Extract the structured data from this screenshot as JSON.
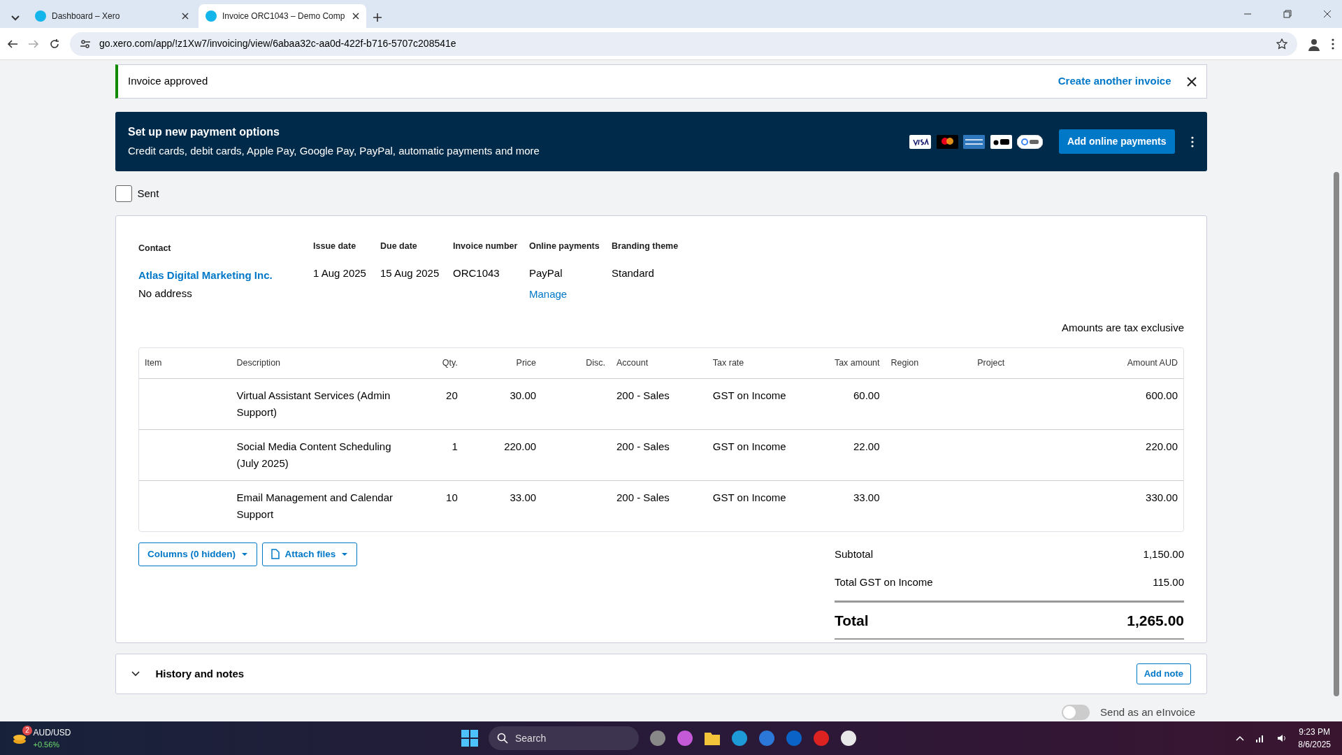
{
  "browser": {
    "tabs": [
      {
        "title": "Dashboard – Xero",
        "selected": false
      },
      {
        "title": "Invoice ORC1043 – Demo Comp",
        "selected": true
      }
    ],
    "url": "go.xero.com/app/!z1Xw7/invoicing/view/6abaa32c-aa0d-422f-b716-5707c208541e"
  },
  "alert": {
    "message": "Invoice approved",
    "action": "Create another invoice"
  },
  "banner": {
    "title": "Set up new payment options",
    "text": "Credit cards, debit cards, Apple Pay, Google Pay, PayPal, automatic payments and more",
    "button": "Add online payments"
  },
  "sent": {
    "label": "Sent",
    "checked": false
  },
  "invoice": {
    "fields": [
      {
        "label": "Contact",
        "kind": "contact",
        "value": "Atlas Digital Marketing Inc.",
        "sub": "No address"
      },
      {
        "label": "Issue date",
        "kind": "text",
        "value": "1 Aug 2025"
      },
      {
        "label": "Due date",
        "kind": "text",
        "value": "15 Aug 2025"
      },
      {
        "label": "Invoice number",
        "kind": "text",
        "value": "ORC1043"
      },
      {
        "label": "Online payments",
        "kind": "link",
        "value": "PayPal",
        "sub": "Manage"
      },
      {
        "label": "Branding theme",
        "kind": "text",
        "value": "Standard"
      }
    ],
    "tax_note": "Amounts are tax exclusive",
    "table": {
      "columns": [
        "Item",
        "Description",
        "Qty.",
        "Price",
        "Disc.",
        "Account",
        "Tax rate",
        "Tax amount",
        "Region",
        "Project",
        "Amount AUD"
      ],
      "rows": [
        [
          "",
          "Virtual Assistant Services (Admin Support)",
          "20",
          "30.00",
          "",
          "200 - Sales",
          "GST on Income",
          "60.00",
          "",
          "",
          "600.00"
        ],
        [
          "",
          "Social Media Content Scheduling (July 2025)",
          "1",
          "220.00",
          "",
          "200 - Sales",
          "GST on Income",
          "22.00",
          "",
          "",
          "220.00"
        ],
        [
          "",
          "Email Management and Calendar Support",
          "10",
          "33.00",
          "",
          "200 - Sales",
          "GST on Income",
          "33.00",
          "",
          "",
          "330.00"
        ]
      ]
    },
    "buttons": [
      "Columns (0 hidden)",
      "Attach files"
    ],
    "totals": [
      {
        "label": "Subtotal",
        "value": "1,150.00"
      },
      {
        "label": "Total GST on Income",
        "value": "115.00"
      }
    ],
    "total": {
      "label": "Total",
      "value": "1,265.00"
    }
  },
  "history": {
    "title": "History and notes",
    "button": "Add note"
  },
  "einvoice": {
    "label": "Send as an eInvoice",
    "on": false
  },
  "taskbar": {
    "ticker": {
      "name": "AUD/USD",
      "change": "+0.56%",
      "badge": "2"
    },
    "search": "Search",
    "time": "9:23 PM",
    "date": "8/6/2025"
  }
}
